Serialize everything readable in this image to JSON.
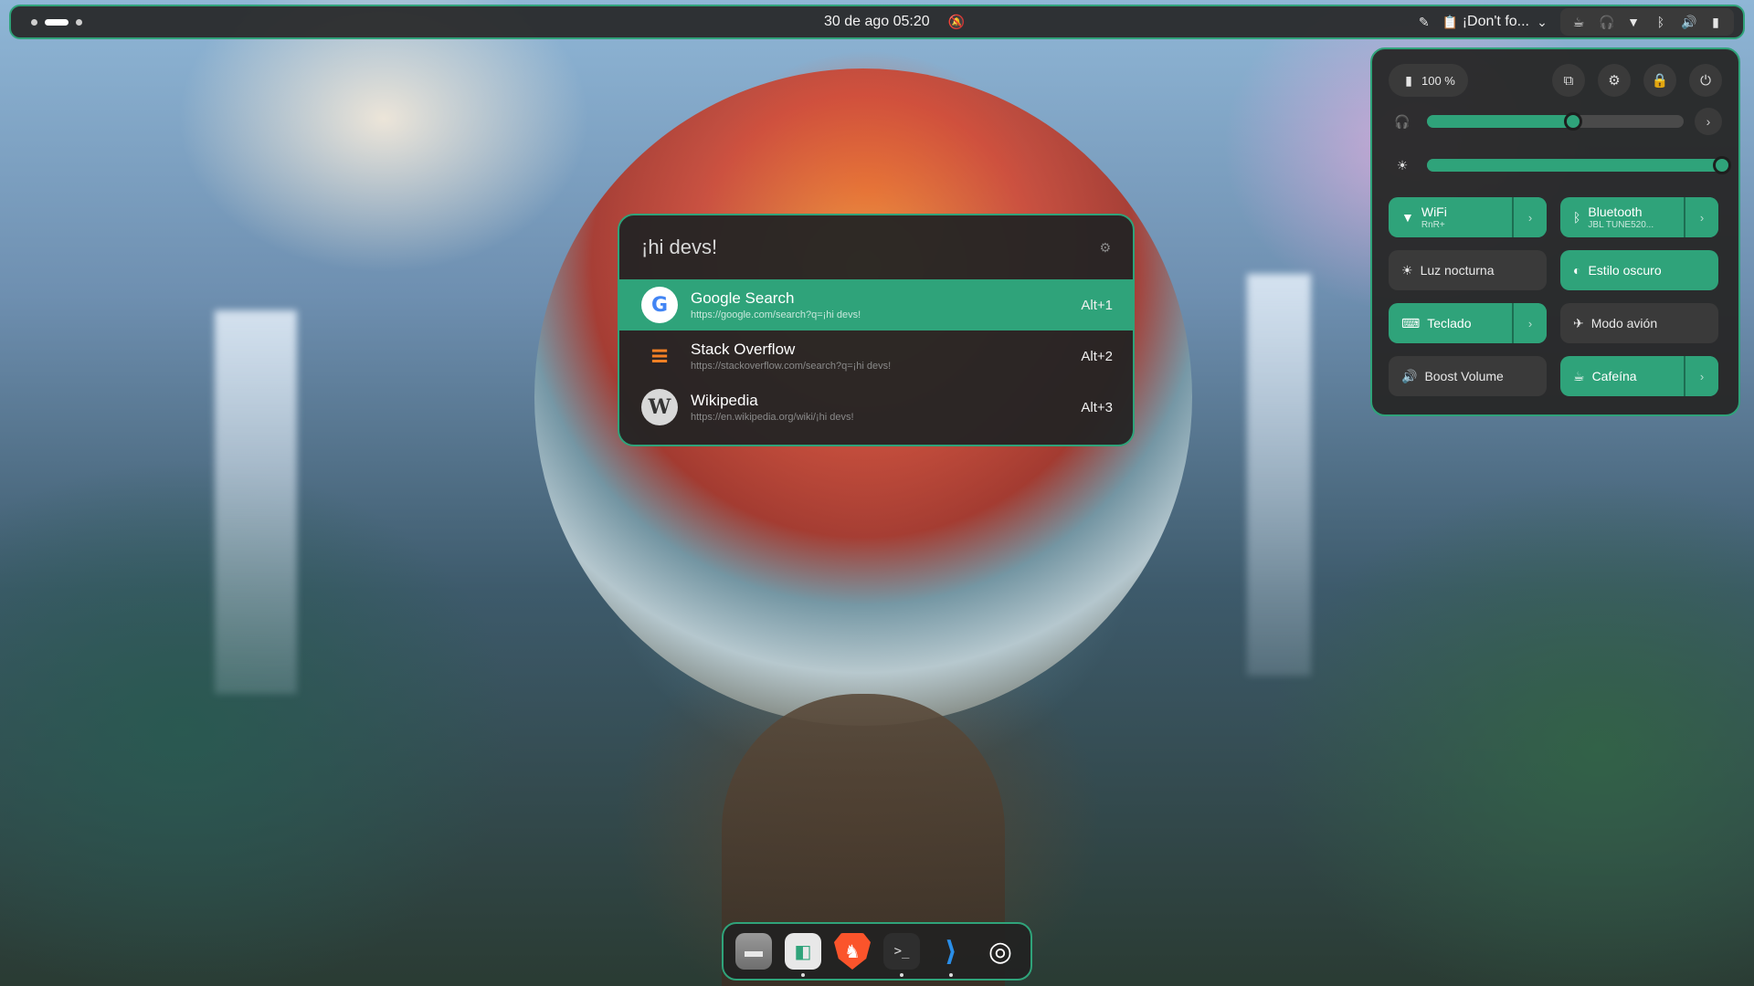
{
  "topbar": {
    "clock": "30 de ago  05:20",
    "clipboard_label": "¡Don't fo...",
    "icons": [
      "eyedropper-icon",
      "clipboard-icon",
      "caffeine-icon",
      "headphones-icon",
      "wifi-icon",
      "bluetooth-icon",
      "volume-icon",
      "battery-icon"
    ]
  },
  "launcher": {
    "query": "¡hi devs!",
    "results": [
      {
        "title": "Google Search",
        "url": "https://google.com/search?q=¡hi devs!",
        "shortcut": "Alt+1",
        "icon": "google-icon",
        "selected": true
      },
      {
        "title": "Stack Overflow",
        "url": "https://stackoverflow.com/search?q=¡hi devs!",
        "shortcut": "Alt+2",
        "icon": "stackoverflow-icon",
        "selected": false
      },
      {
        "title": "Wikipedia",
        "url": "https://en.wikipedia.org/wiki/¡hi devs!",
        "shortcut": "Alt+3",
        "icon": "wikipedia-icon",
        "selected": false
      }
    ]
  },
  "quick_settings": {
    "battery": "100 %",
    "volume_level": 0.57,
    "brightness_level": 1.0,
    "tiles": [
      {
        "label": "WiFi",
        "sub": "RnR+",
        "icon": "wifi-icon",
        "on": true,
        "arrow": true
      },
      {
        "label": "Bluetooth",
        "sub": "JBL TUNE520...",
        "icon": "bluetooth-icon",
        "on": true,
        "arrow": true
      },
      {
        "label": "Luz nocturna",
        "sub": "",
        "icon": "night-light-icon",
        "on": false,
        "arrow": false
      },
      {
        "label": "Estilo oscuro",
        "sub": "",
        "icon": "dark-style-icon",
        "on": true,
        "arrow": false
      },
      {
        "label": "Teclado",
        "sub": "",
        "icon": "keyboard-icon",
        "on": true,
        "arrow": true
      },
      {
        "label": "Modo avión",
        "sub": "",
        "icon": "airplane-icon",
        "on": false,
        "arrow": false
      },
      {
        "label": "Boost Volume",
        "sub": "",
        "icon": "volume-icon",
        "on": false,
        "arrow": false
      },
      {
        "label": "Cafeína",
        "sub": "",
        "icon": "caffeine-icon",
        "on": true,
        "arrow": true
      }
    ]
  },
  "dock": {
    "apps": [
      {
        "name": "files-icon",
        "running": false
      },
      {
        "name": "settings-app-icon",
        "running": true
      },
      {
        "name": "brave-icon",
        "running": true
      },
      {
        "name": "terminal-icon",
        "running": true
      },
      {
        "name": "vscode-icon",
        "running": true
      },
      {
        "name": "ubuntu-icon",
        "running": false
      }
    ]
  },
  "colors": {
    "accent": "#2fa37a",
    "panel": "#282828",
    "tile": "#3a3a3a"
  }
}
